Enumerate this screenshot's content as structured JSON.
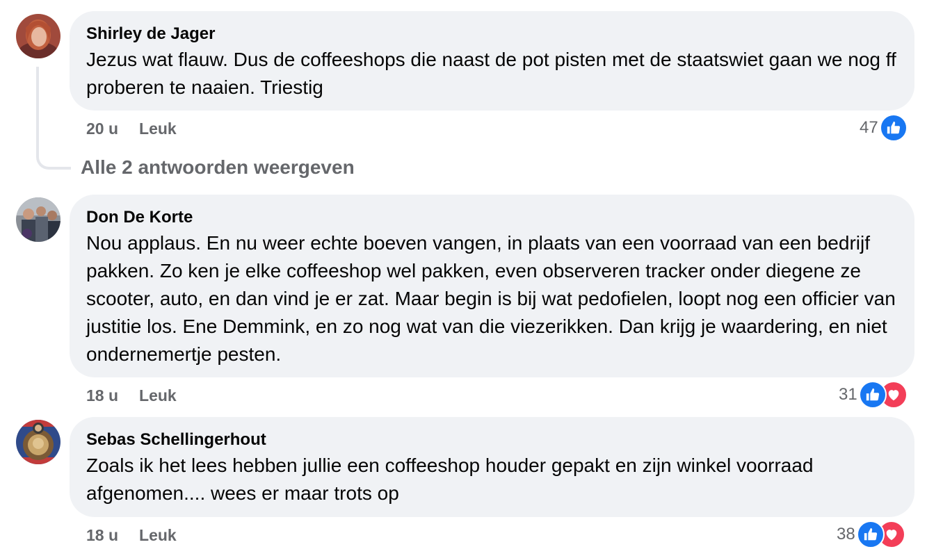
{
  "comments": [
    {
      "author": "Shirley de Jager",
      "text": "Jezus wat flauw. Dus de coffeeshops die naast de pot pisten met de staatswiet gaan we nog ff proberen te naaien. Triestig",
      "time": "20 u",
      "like_label": "Leuk",
      "reaction_count": "47",
      "reactions": [
        "like-icon"
      ]
    },
    {
      "author": "Don De Korte",
      "text": "Nou applaus. En nu weer echte boeven vangen, in plaats van een voorraad van een bedrijf pakken. Zo ken je elke coffeeshop wel pakken, even observeren tracker onder diegene ze scooter, auto, en dan vind je er zat. Maar begin is bij wat pedofielen, loopt nog een officier van justitie los. Ene Demmink, en zo nog wat van die viezerikken. Dan krijg je waardering, en niet ondernemertje pesten.",
      "time": "18 u",
      "like_label": "Leuk",
      "reaction_count": "31",
      "reactions": [
        "like-icon",
        "love-icon"
      ]
    },
    {
      "author": "Sebas Schellingerhout",
      "text": "Zoals ik het lees hebben jullie een coffeeshop houder gepakt en zijn winkel voorraad afgenomen.... wees er maar trots op",
      "time": "18 u",
      "like_label": "Leuk",
      "reaction_count": "38",
      "reactions": [
        "like-icon",
        "love-icon"
      ]
    }
  ],
  "replies": {
    "view_all_label": "Alle 2 antwoorden weergeven"
  },
  "colors": {
    "bubble_bg": "#f0f2f5",
    "secondary_text": "#65676b",
    "like_blue": "#1877f2",
    "love_red": "#f33e58"
  }
}
